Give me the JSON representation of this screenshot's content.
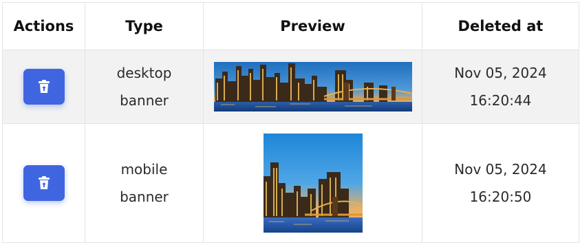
{
  "table": {
    "headers": [
      "Actions",
      "Type",
      "Preview",
      "Deleted at"
    ],
    "rows": [
      {
        "type_line1": "desktop",
        "type_line2": "banner",
        "deleted_date": "Nov 05, 2024",
        "deleted_time": "16:20:44",
        "action_icon": "trash-restore-icon",
        "preview": "desktop-banner-image"
      },
      {
        "type_line1": "mobile",
        "type_line2": "banner",
        "deleted_date": "Nov 05, 2024",
        "deleted_time": "16:20:50",
        "action_icon": "trash-restore-icon",
        "preview": "mobile-banner-image"
      }
    ]
  },
  "colors": {
    "button": "#3f66e0",
    "row_highlight": "#f2f2f2",
    "border": "#e4e4e4"
  }
}
